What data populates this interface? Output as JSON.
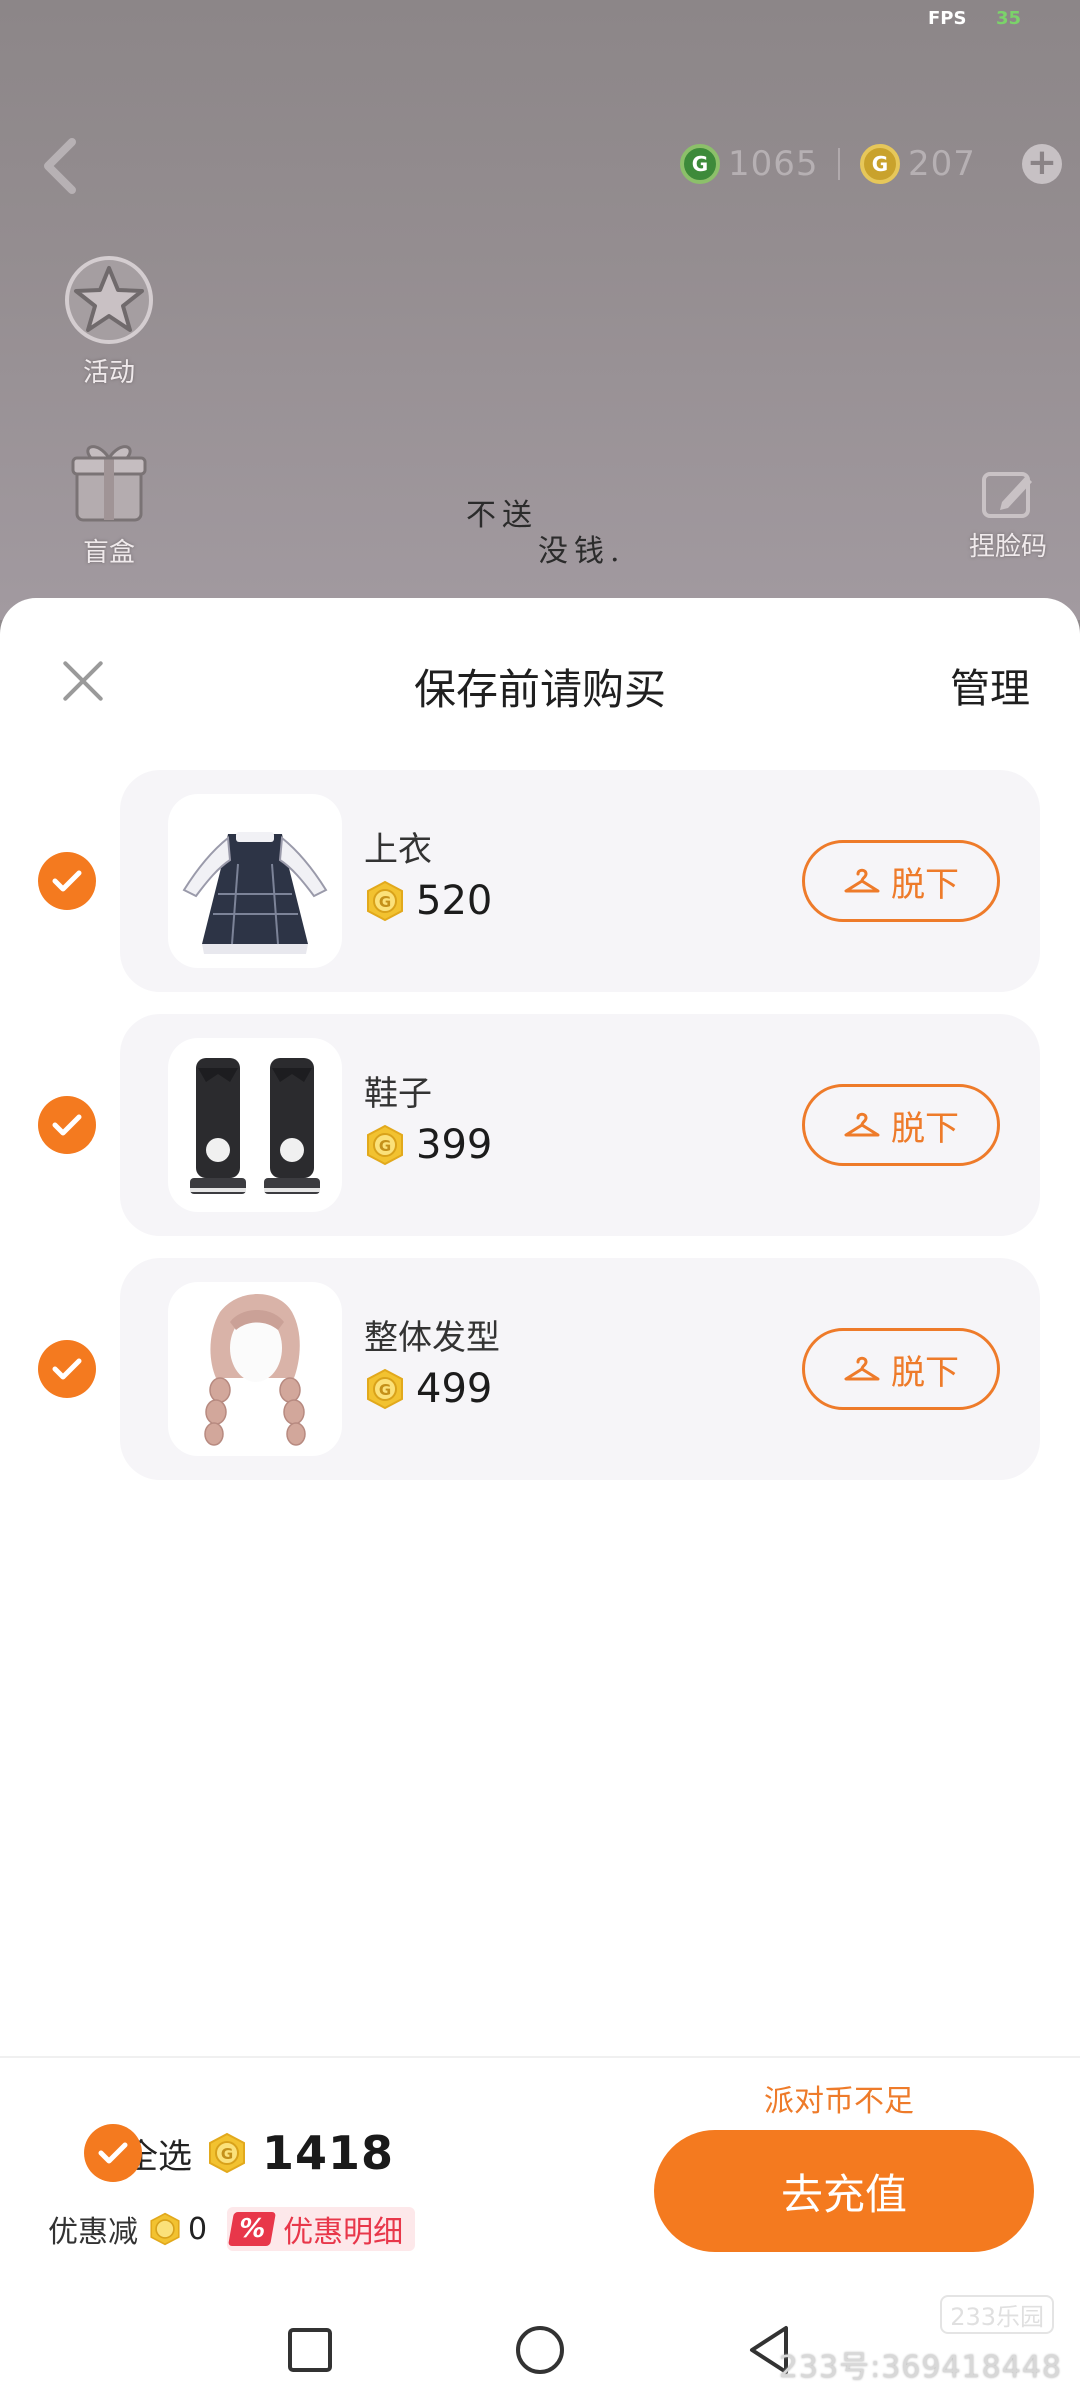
{
  "status": {
    "fps_label": "FPS",
    "fps_value": "35"
  },
  "game_hud": {
    "green_currency": "1065",
    "gold_currency": "207",
    "side_buttons": [
      {
        "label": "活动",
        "icon": "star-badge-icon"
      },
      {
        "label": "盲盒",
        "icon": "gift-box-icon"
      }
    ],
    "handwriting_line1": "不送",
    "handwriting_line2": "没钱.",
    "face_code_label": "捏脸码"
  },
  "sheet": {
    "title": "保存前请购买",
    "manage_label": "管理",
    "items": [
      {
        "name": "上衣",
        "price": "520",
        "remove_label": "脱下",
        "checked": true
      },
      {
        "name": "鞋子",
        "price": "399",
        "remove_label": "脱下",
        "checked": true
      },
      {
        "name": "整体发型",
        "price": "499",
        "remove_label": "脱下",
        "checked": true
      }
    ]
  },
  "footer": {
    "warning": "派对币不足",
    "select_all_label": "全选",
    "total": "1418",
    "discount_label": "优惠减",
    "discount_value": "0",
    "discount_badge": "%",
    "discount_detail_label": "优惠明细",
    "recharge_label": "去充值"
  },
  "watermark": {
    "text": "233号:369418448",
    "logo": "233乐园"
  },
  "colors": {
    "accent": "#f47a1f",
    "coin": "#f2c230",
    "discount_red": "#e8374a"
  }
}
